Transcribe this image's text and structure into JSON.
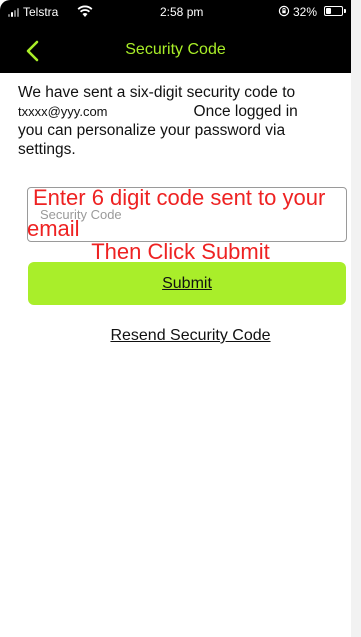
{
  "status_bar": {
    "carrier": "Telstra",
    "time": "2:58 pm",
    "battery_percent": "32%",
    "signal_icon": "cellular-signal-icon",
    "wifi_icon": "wifi-icon",
    "rotation_lock_icon": "rotation-lock-icon",
    "battery_icon": "battery-icon",
    "battery_level": 0.32
  },
  "nav": {
    "title": "Security Code",
    "back_icon": "chevron-left-icon"
  },
  "message": {
    "line1": "We have sent a six-digit security code to",
    "email": "txxxx@yyy.com",
    "line2_suffix": "Once logged in",
    "line3": "you can personalize your password via settings."
  },
  "code_input": {
    "placeholder": "Security Code",
    "value": ""
  },
  "annotations": {
    "line1": "Enter 6 digit code sent to your",
    "line2": "email",
    "line3": "Then Click Submit"
  },
  "actions": {
    "submit_label": "Submit",
    "resend_label": "Resend Security Code"
  },
  "colors": {
    "accent": "#a9ee28",
    "header_bg": "#000000",
    "annotation": "#ee2222"
  }
}
